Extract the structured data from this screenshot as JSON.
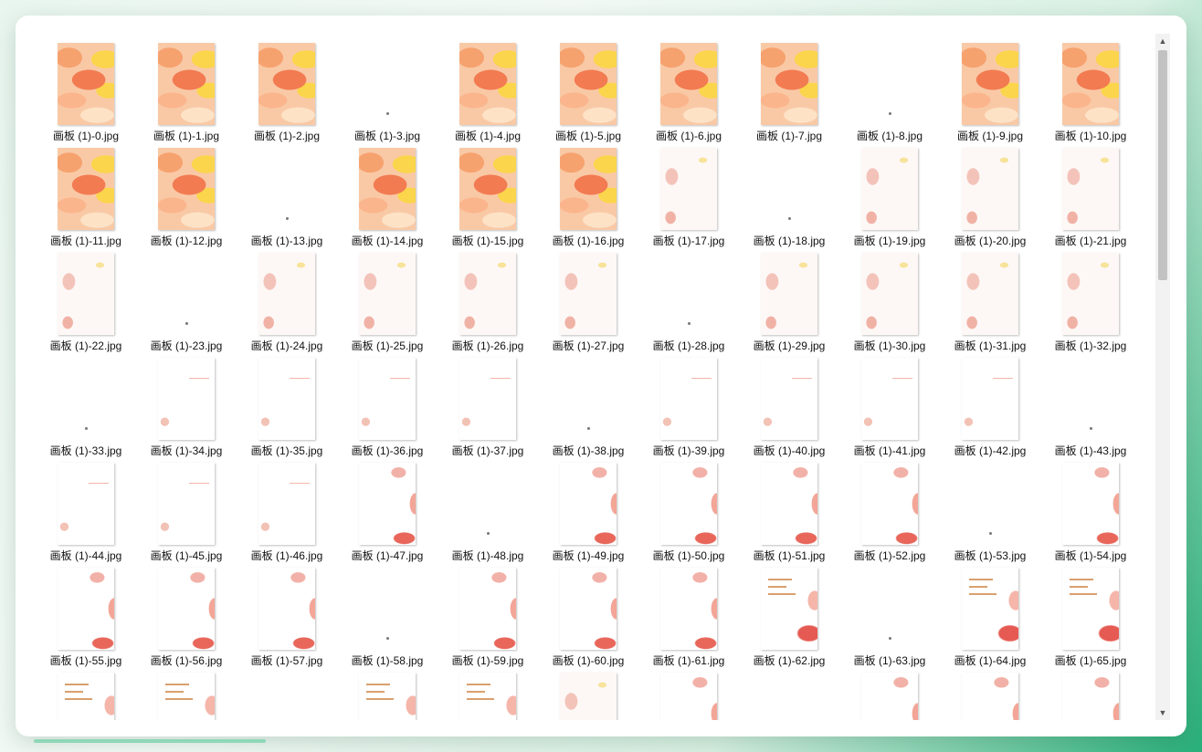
{
  "files": [
    {
      "name": "画板 (1)-0.jpg",
      "thumb": "orange"
    },
    {
      "name": "画板 (1)-1.jpg",
      "thumb": "orange"
    },
    {
      "name": "画板 (1)-2.jpg",
      "thumb": "orange"
    },
    {
      "name": "画板 (1)-3.jpg",
      "thumb": "none"
    },
    {
      "name": "画板 (1)-4.jpg",
      "thumb": "orange"
    },
    {
      "name": "画板 (1)-5.jpg",
      "thumb": "orange"
    },
    {
      "name": "画板 (1)-6.jpg",
      "thumb": "orange"
    },
    {
      "name": "画板 (1)-7.jpg",
      "thumb": "orange"
    },
    {
      "name": "画板 (1)-8.jpg",
      "thumb": "none"
    },
    {
      "name": "画板 (1)-9.jpg",
      "thumb": "orange"
    },
    {
      "name": "画板 (1)-10.jpg",
      "thumb": "orange"
    },
    {
      "name": "画板 (1)-11.jpg",
      "thumb": "orange"
    },
    {
      "name": "画板 (1)-12.jpg",
      "thumb": "orange"
    },
    {
      "name": "画板 (1)-13.jpg",
      "thumb": "none"
    },
    {
      "name": "画板 (1)-14.jpg",
      "thumb": "orange"
    },
    {
      "name": "画板 (1)-15.jpg",
      "thumb": "orange"
    },
    {
      "name": "画板 (1)-16.jpg",
      "thumb": "orange"
    },
    {
      "name": "画板 (1)-17.jpg",
      "thumb": "light"
    },
    {
      "name": "画板 (1)-18.jpg",
      "thumb": "none"
    },
    {
      "name": "画板 (1)-19.jpg",
      "thumb": "light"
    },
    {
      "name": "画板 (1)-20.jpg",
      "thumb": "light"
    },
    {
      "name": "画板 (1)-21.jpg",
      "thumb": "light"
    },
    {
      "name": "画板 (1)-22.jpg",
      "thumb": "light"
    },
    {
      "name": "画板 (1)-23.jpg",
      "thumb": "none"
    },
    {
      "name": "画板 (1)-24.jpg",
      "thumb": "light"
    },
    {
      "name": "画板 (1)-25.jpg",
      "thumb": "light"
    },
    {
      "name": "画板 (1)-26.jpg",
      "thumb": "light"
    },
    {
      "name": "画板 (1)-27.jpg",
      "thumb": "light"
    },
    {
      "name": "画板 (1)-28.jpg",
      "thumb": "none"
    },
    {
      "name": "画板 (1)-29.jpg",
      "thumb": "light"
    },
    {
      "name": "画板 (1)-30.jpg",
      "thumb": "light"
    },
    {
      "name": "画板 (1)-31.jpg",
      "thumb": "light"
    },
    {
      "name": "画板 (1)-32.jpg",
      "thumb": "light"
    },
    {
      "name": "画板 (1)-33.jpg",
      "thumb": "none"
    },
    {
      "name": "画板 (1)-34.jpg",
      "thumb": "white"
    },
    {
      "name": "画板 (1)-35.jpg",
      "thumb": "white"
    },
    {
      "name": "画板 (1)-36.jpg",
      "thumb": "white"
    },
    {
      "name": "画板 (1)-37.jpg",
      "thumb": "white"
    },
    {
      "name": "画板 (1)-38.jpg",
      "thumb": "none"
    },
    {
      "name": "画板 (1)-39.jpg",
      "thumb": "white"
    },
    {
      "name": "画板 (1)-40.jpg",
      "thumb": "white"
    },
    {
      "name": "画板 (1)-41.jpg",
      "thumb": "white"
    },
    {
      "name": "画板 (1)-42.jpg",
      "thumb": "white"
    },
    {
      "name": "画板 (1)-43.jpg",
      "thumb": "none"
    },
    {
      "name": "画板 (1)-44.jpg",
      "thumb": "white"
    },
    {
      "name": "画板 (1)-45.jpg",
      "thumb": "white"
    },
    {
      "name": "画板 (1)-46.jpg",
      "thumb": "white"
    },
    {
      "name": "画板 (1)-47.jpg",
      "thumb": "pink"
    },
    {
      "name": "画板 (1)-48.jpg",
      "thumb": "none"
    },
    {
      "name": "画板 (1)-49.jpg",
      "thumb": "pink"
    },
    {
      "name": "画板 (1)-50.jpg",
      "thumb": "pink"
    },
    {
      "name": "画板 (1)-51.jpg",
      "thumb": "pink"
    },
    {
      "name": "画板 (1)-52.jpg",
      "thumb": "pink"
    },
    {
      "name": "画板 (1)-53.jpg",
      "thumb": "none"
    },
    {
      "name": "画板 (1)-54.jpg",
      "thumb": "pink"
    },
    {
      "name": "画板 (1)-55.jpg",
      "thumb": "pink"
    },
    {
      "name": "画板 (1)-56.jpg",
      "thumb": "pink"
    },
    {
      "name": "画板 (1)-57.jpg",
      "thumb": "pink"
    },
    {
      "name": "画板 (1)-58.jpg",
      "thumb": "none"
    },
    {
      "name": "画板 (1)-59.jpg",
      "thumb": "pink"
    },
    {
      "name": "画板 (1)-60.jpg",
      "thumb": "pink"
    },
    {
      "name": "画板 (1)-61.jpg",
      "thumb": "pink"
    },
    {
      "name": "画板 (1)-62.jpg",
      "thumb": "text"
    },
    {
      "name": "画板 (1)-63.jpg",
      "thumb": "none"
    },
    {
      "name": "画板 (1)-64.jpg",
      "thumb": "text"
    },
    {
      "name": "画板 (1)-65.jpg",
      "thumb": "text"
    },
    {
      "name": "",
      "thumb": "text"
    },
    {
      "name": "",
      "thumb": "text"
    },
    {
      "name": "",
      "thumb": "none"
    },
    {
      "name": "",
      "thumb": "text"
    },
    {
      "name": "",
      "thumb": "text"
    },
    {
      "name": "",
      "thumb": "light"
    },
    {
      "name": "",
      "thumb": "pink"
    },
    {
      "name": "",
      "thumb": "none"
    },
    {
      "name": "",
      "thumb": "pink"
    },
    {
      "name": "",
      "thumb": "pink"
    },
    {
      "name": "",
      "thumb": "pink"
    }
  ],
  "scrollbar": {
    "up_icon": "▲",
    "down_icon": "▼",
    "position": 0.0
  },
  "colors": {
    "accent": "#29b07a",
    "window_bg": "#ffffff"
  }
}
